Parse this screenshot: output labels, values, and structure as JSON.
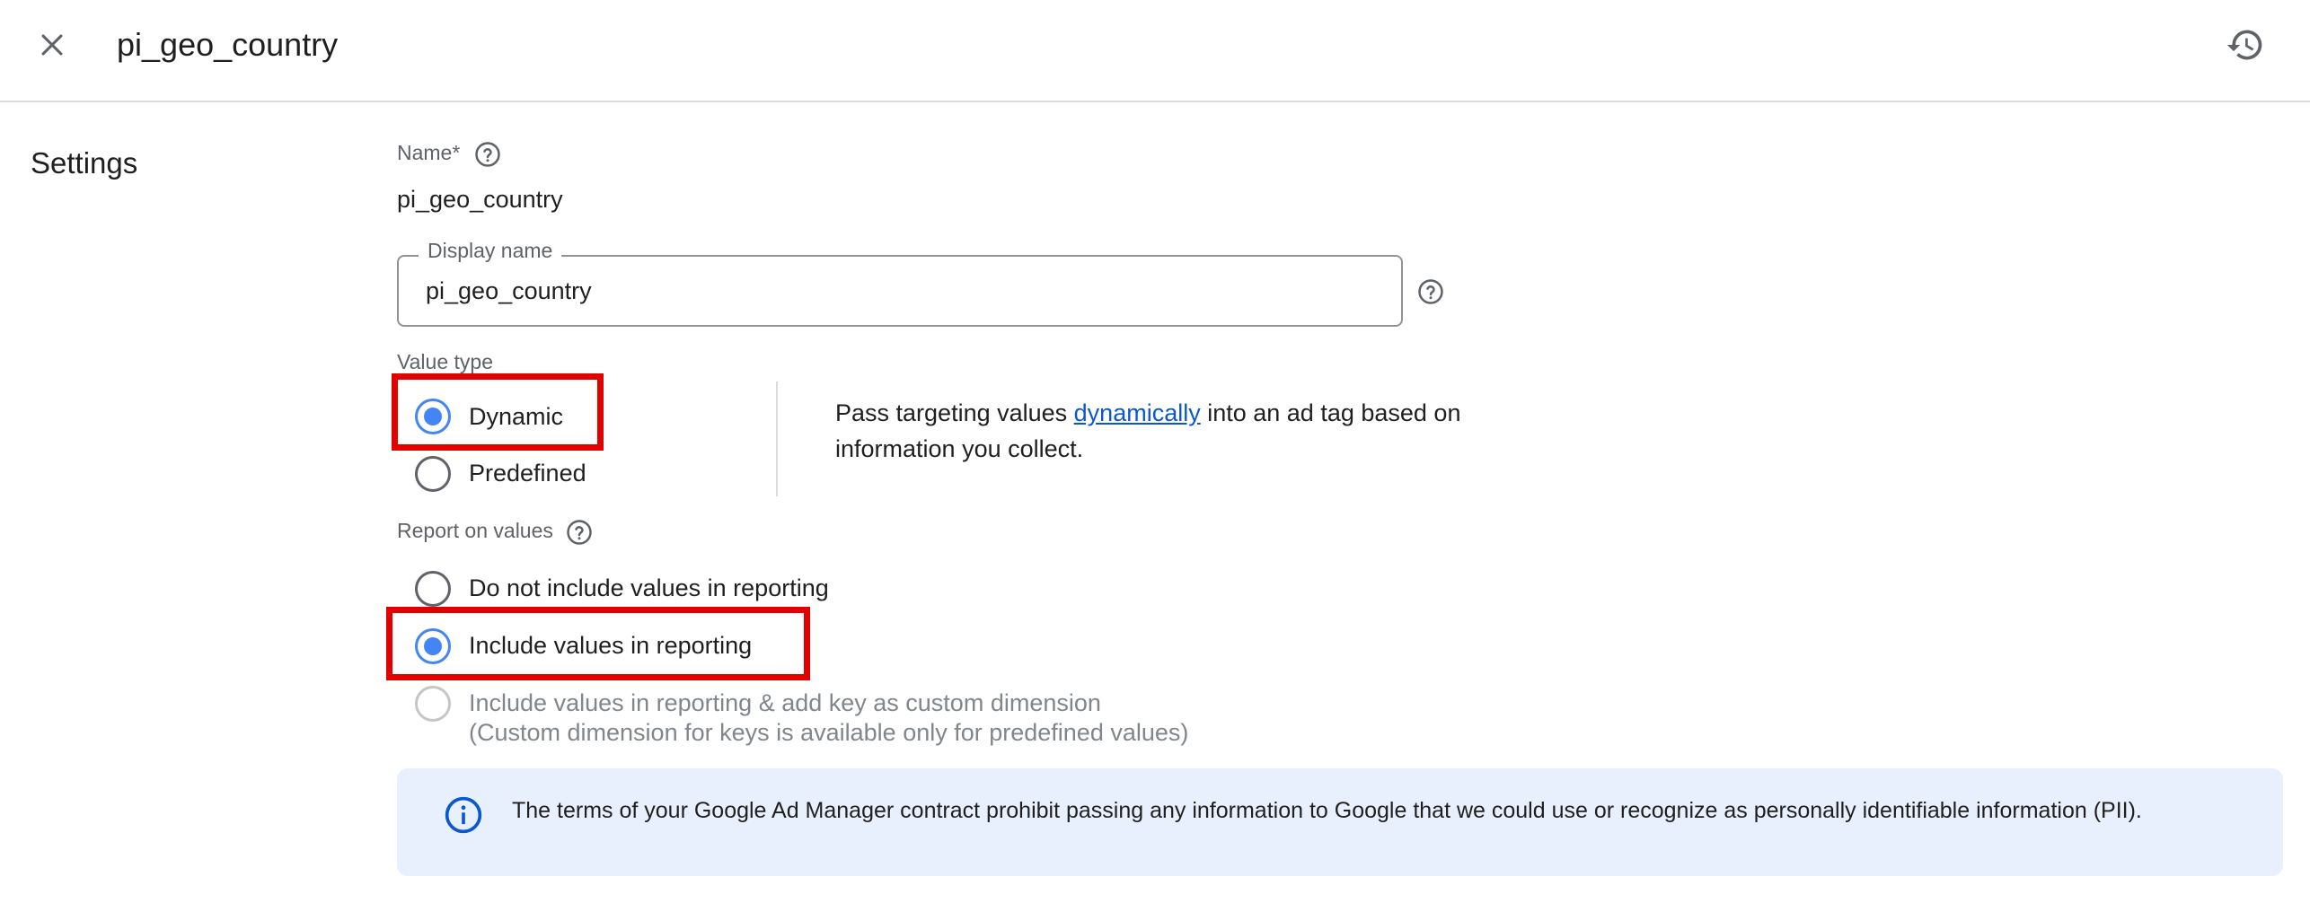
{
  "header": {
    "title": "pi_geo_country",
    "close_icon": "close-icon",
    "history_icon": "history-icon"
  },
  "settings": {
    "section_title": "Settings",
    "name_label": "Name*",
    "name_value": "pi_geo_country",
    "display_name": {
      "label": "Display name",
      "value": "pi_geo_country"
    },
    "value_type": {
      "label": "Value type",
      "options": [
        {
          "label": "Dynamic",
          "selected": true
        },
        {
          "label": "Predefined",
          "selected": false
        }
      ],
      "description_before": "Pass targeting values ",
      "description_link": "dynamically",
      "description_after": " into an ad tag based on information you collect."
    },
    "report_on_values": {
      "label": "Report on values",
      "options": [
        {
          "label": "Do not include values in reporting",
          "selected": false
        },
        {
          "label": "Include values in reporting",
          "selected": true
        },
        {
          "label": "Include values in reporting & add key as custom dimension",
          "sublabel": "(Custom dimension for keys is available only for predefined values)",
          "selected": false,
          "disabled": true
        }
      ]
    },
    "info_banner": {
      "icon": "info-icon",
      "text": "The terms of your Google Ad Manager contract prohibit passing any information to Google that we could use or recognize as personally identifiable information (PII)."
    }
  },
  "colors": {
    "accent": "#4285f4",
    "highlight": "#e10000",
    "banner_bg": "#e8f0fe"
  }
}
